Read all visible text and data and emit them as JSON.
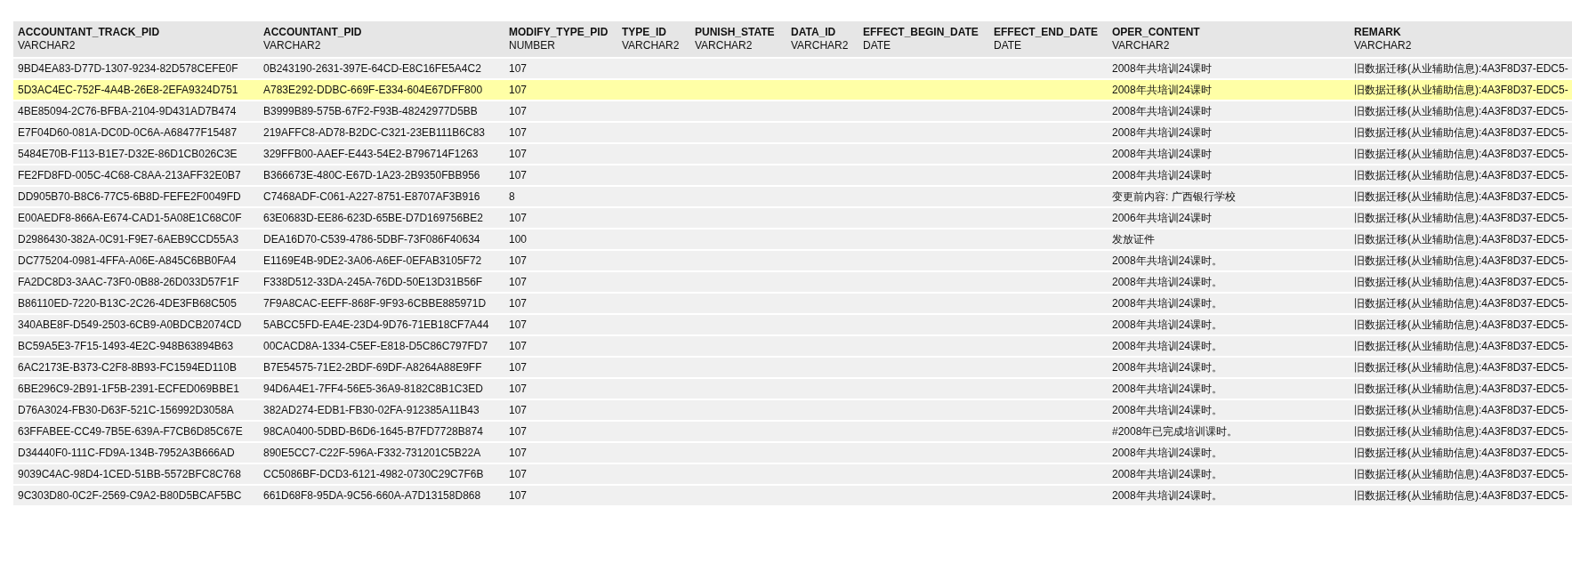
{
  "table": {
    "columns": [
      {
        "name": "ACCOUNTANT_TRACK_PID",
        "type": "VARCHAR2"
      },
      {
        "name": "ACCOUNTANT_PID",
        "type": "VARCHAR2"
      },
      {
        "name": "MODIFY_TYPE_PID",
        "type": "NUMBER"
      },
      {
        "name": "TYPE_ID",
        "type": "VARCHAR2"
      },
      {
        "name": "PUNISH_STATE",
        "type": "VARCHAR2"
      },
      {
        "name": "DATA_ID",
        "type": "VARCHAR2"
      },
      {
        "name": "EFFECT_BEGIN_DATE",
        "type": "DATE"
      },
      {
        "name": "EFFECT_END_DATE",
        "type": "DATE"
      },
      {
        "name": "OPER_CONTENT",
        "type": "VARCHAR2"
      },
      {
        "name": "REMARK",
        "type": "VARCHAR2"
      }
    ],
    "rows": [
      {
        "selected": false,
        "accountant_track_pid": "9BD4EA83-D77D-1307-9234-82D578CEFE0F",
        "accountant_pid": "0B243190-2631-397E-64CD-E8C16FE5A4C2",
        "modify_type_pid": "107",
        "oper_content": "2008年共培训24课时",
        "remark": "旧数据迁移(从业辅助信息):4A3F8D37-EDC5-"
      },
      {
        "selected": true,
        "accountant_track_pid": "5D3AC4EC-752F-4A4B-26E8-2EFA9324D751",
        "accountant_pid": "A783E292-DDBC-669F-E334-604E67DFF800",
        "modify_type_pid": "107",
        "oper_content": "2008年共培训24课时",
        "remark": "旧数据迁移(从业辅助信息):4A3F8D37-EDC5-"
      },
      {
        "selected": false,
        "accountant_track_pid": "4BE85094-2C76-BFBA-2104-9D431AD7B474",
        "accountant_pid": "B3999B89-575B-67F2-F93B-48242977D5BB",
        "modify_type_pid": "107",
        "oper_content": "2008年共培训24课时",
        "remark": "旧数据迁移(从业辅助信息):4A3F8D37-EDC5-"
      },
      {
        "selected": false,
        "accountant_track_pid": "E7F04D60-081A-DC0D-0C6A-A68477F15487",
        "accountant_pid": "219AFFC8-AD78-B2DC-C321-23EB111B6C83",
        "modify_type_pid": "107",
        "oper_content": "2008年共培训24课时",
        "remark": "旧数据迁移(从业辅助信息):4A3F8D37-EDC5-"
      },
      {
        "selected": false,
        "accountant_track_pid": "5484E70B-F113-B1E7-D32E-86D1CB026C3E",
        "accountant_pid": "329FFB00-AAEF-E443-54E2-B796714F1263",
        "modify_type_pid": "107",
        "oper_content": "2008年共培训24课时",
        "remark": "旧数据迁移(从业辅助信息):4A3F8D37-EDC5-"
      },
      {
        "selected": false,
        "accountant_track_pid": "FE2FD8FD-005C-4C68-C8AA-213AFF32E0B7",
        "accountant_pid": "B366673E-480C-E67D-1A23-2B9350FBB956",
        "modify_type_pid": "107",
        "oper_content": "2008年共培训24课时",
        "remark": "旧数据迁移(从业辅助信息):4A3F8D37-EDC5-"
      },
      {
        "selected": false,
        "accountant_track_pid": "DD905B70-B8C6-77C5-6B8D-FEFE2F0049FD",
        "accountant_pid": "C7468ADF-C061-A227-8751-E8707AF3B916",
        "modify_type_pid": "8",
        "oper_content": "变更前内容: 广西银行学校",
        "remark": "旧数据迁移(从业辅助信息):4A3F8D37-EDC5-"
      },
      {
        "selected": false,
        "accountant_track_pid": "E00AEDF8-866A-E674-CAD1-5A08E1C68C0F",
        "accountant_pid": "63E0683D-EE86-623D-65BE-D7D169756BE2",
        "modify_type_pid": "107",
        "oper_content": "2006年共培训24课时",
        "remark": "旧数据迁移(从业辅助信息):4A3F8D37-EDC5-"
      },
      {
        "selected": false,
        "accountant_track_pid": "D2986430-382A-0C91-F9E7-6AEB9CCD55A3",
        "accountant_pid": "DEA16D70-C539-4786-5DBF-73F086F40634",
        "modify_type_pid": "100",
        "oper_content": "发放证件",
        "remark": "旧数据迁移(从业辅助信息):4A3F8D37-EDC5-"
      },
      {
        "selected": false,
        "accountant_track_pid": "DC775204-0981-4FFA-A06E-A845C6BB0FA4",
        "accountant_pid": "E1169E4B-9DE2-3A06-A6EF-0EFAB3105F72",
        "modify_type_pid": "107",
        "oper_content": "2008年共培训24课时。",
        "remark": "旧数据迁移(从业辅助信息):4A3F8D37-EDC5-"
      },
      {
        "selected": false,
        "accountant_track_pid": "FA2DC8D3-3AAC-73F0-0B88-26D033D57F1F",
        "accountant_pid": "F338D512-33DA-245A-76DD-50E13D31B56F",
        "modify_type_pid": "107",
        "oper_content": "2008年共培训24课时。",
        "remark": "旧数据迁移(从业辅助信息):4A3F8D37-EDC5-"
      },
      {
        "selected": false,
        "accountant_track_pid": "B86110ED-7220-B13C-2C26-4DE3FB68C505",
        "accountant_pid": "7F9A8CAC-EEFF-868F-9F93-6CBBE885971D",
        "modify_type_pid": "107",
        "oper_content": "2008年共培训24课时。",
        "remark": "旧数据迁移(从业辅助信息):4A3F8D37-EDC5-"
      },
      {
        "selected": false,
        "accountant_track_pid": "340ABE8F-D549-2503-6CB9-A0BDCB2074CD",
        "accountant_pid": "5ABCC5FD-EA4E-23D4-9D76-71EB18CF7A44",
        "modify_type_pid": "107",
        "oper_content": "2008年共培训24课时。",
        "remark": "旧数据迁移(从业辅助信息):4A3F8D37-EDC5-"
      },
      {
        "selected": false,
        "accountant_track_pid": "BC59A5E3-7F15-1493-4E2C-948B63894B63",
        "accountant_pid": "00CACD8A-1334-C5EF-E818-D5C86C797FD7",
        "modify_type_pid": "107",
        "oper_content": "2008年共培训24课时。",
        "remark": "旧数据迁移(从业辅助信息):4A3F8D37-EDC5-"
      },
      {
        "selected": false,
        "accountant_track_pid": "6AC2173E-B373-C2F8-8B93-FC1594ED110B",
        "accountant_pid": "B7E54575-71E2-2BDF-69DF-A8264A88E9FF",
        "modify_type_pid": "107",
        "oper_content": "2008年共培训24课时。",
        "remark": "旧数据迁移(从业辅助信息):4A3F8D37-EDC5-"
      },
      {
        "selected": false,
        "accountant_track_pid": "6BE296C9-2B91-1F5B-2391-ECFED069BBE1",
        "accountant_pid": "94D6A4E1-7FF4-56E5-36A9-8182C8B1C3ED",
        "modify_type_pid": "107",
        "oper_content": "2008年共培训24课时。",
        "remark": "旧数据迁移(从业辅助信息):4A3F8D37-EDC5-"
      },
      {
        "selected": false,
        "accountant_track_pid": "D76A3024-FB30-D63F-521C-156992D3058A",
        "accountant_pid": "382AD274-EDB1-FB30-02FA-912385A11B43",
        "modify_type_pid": "107",
        "oper_content": "2008年共培训24课时。",
        "remark": "旧数据迁移(从业辅助信息):4A3F8D37-EDC5-"
      },
      {
        "selected": false,
        "accountant_track_pid": "63FFABEE-CC49-7B5E-639A-F7CB6D85C67E",
        "accountant_pid": "98CA0400-5DBD-B6D6-1645-B7FD7728B874",
        "modify_type_pid": "107",
        "oper_content": "#2008年已完成培训课时。",
        "remark": "旧数据迁移(从业辅助信息):4A3F8D37-EDC5-"
      },
      {
        "selected": false,
        "accountant_track_pid": "D34440F0-111C-FD9A-134B-7952A3B666AD",
        "accountant_pid": "890E5CC7-C22F-596A-F332-731201C5B22A",
        "modify_type_pid": "107",
        "oper_content": "2008年共培训24课时。",
        "remark": "旧数据迁移(从业辅助信息):4A3F8D37-EDC5-"
      },
      {
        "selected": false,
        "accountant_track_pid": "9039C4AC-98D4-1CED-51BB-5572BFC8C768",
        "accountant_pid": "CC5086BF-DCD3-6121-4982-0730C29C7F6B",
        "modify_type_pid": "107",
        "oper_content": "2008年共培训24课时。",
        "remark": "旧数据迁移(从业辅助信息):4A3F8D37-EDC5-"
      },
      {
        "selected": false,
        "accountant_track_pid": "9C303D80-0C2F-2569-C9A2-B80D5BCAF5BC",
        "accountant_pid": "661D68F8-95DA-9C56-660A-A7D13158D868",
        "modify_type_pid": "107",
        "oper_content": "2008年共培训24课时。",
        "remark": "旧数据迁移(从业辅助信息):4A3F8D37-EDC5-"
      }
    ]
  }
}
